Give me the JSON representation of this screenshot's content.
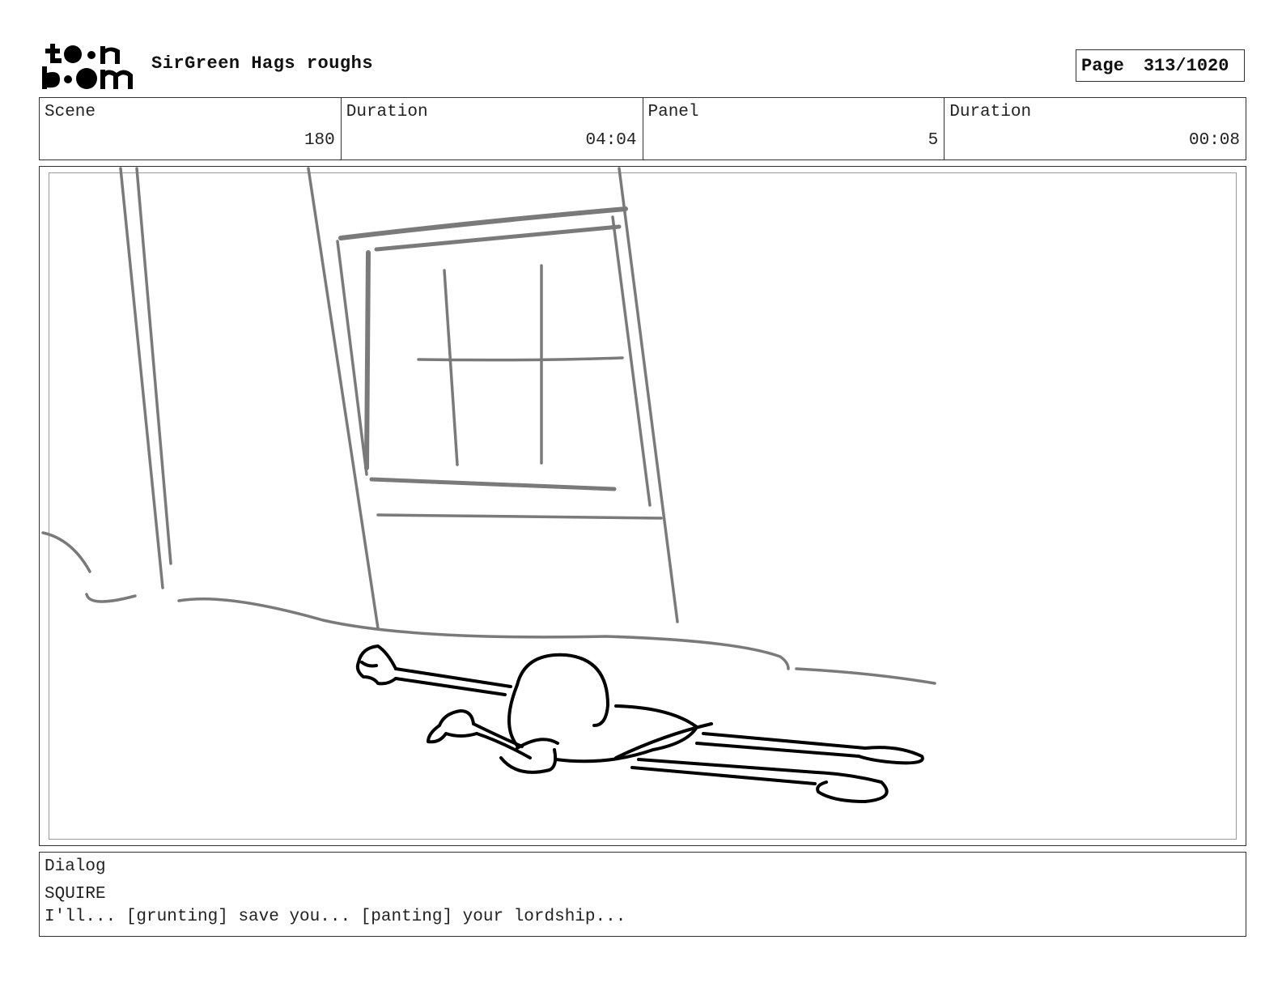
{
  "header": {
    "logo_text": "toon boom",
    "project_title": "SirGreen Hags roughs",
    "page_label": "Page",
    "page_number": "313/1020"
  },
  "info": {
    "scene_label": "Scene",
    "scene_value": "180",
    "scene_duration_label": "Duration",
    "scene_duration_value": "04:04",
    "panel_label": "Panel",
    "panel_value": "5",
    "panel_duration_label": "Duration",
    "panel_duration_value": "00:08"
  },
  "dialog": {
    "label": "Dialog",
    "speaker": "SQUIRE",
    "line": "I'll... [grunting] save you... [panting] your lordship..."
  },
  "colors": {
    "border": "#333333",
    "sketch_gray": "#7a7a7a",
    "sketch_black": "#000000"
  }
}
